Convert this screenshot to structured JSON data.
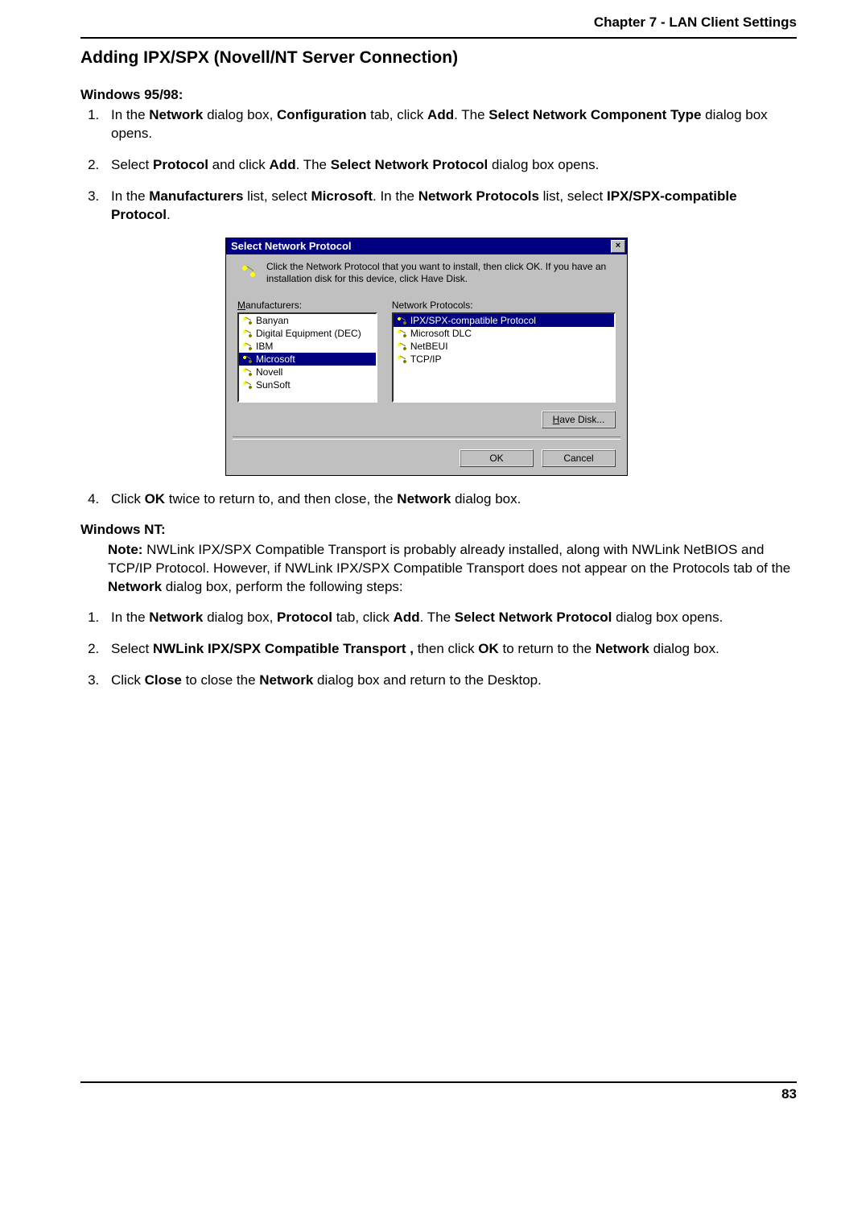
{
  "header": {
    "chapter": "Chapter 7 - LAN Client Settings"
  },
  "section": {
    "title": "Adding IPX/SPX (Novell/NT Server Connection)"
  },
  "win9598": {
    "heading": "Windows 95/98:",
    "step1_a": "In the ",
    "step1_b": "Network",
    "step1_c": " dialog box, ",
    "step1_d": "Configuration",
    "step1_e": " tab, click ",
    "step1_f": "Add",
    "step1_g": ". The ",
    "step1_h": "Select Network Component Type",
    "step1_i": " dialog box opens.",
    "step2_a": "Select ",
    "step2_b": "Protocol",
    "step2_c": " and click ",
    "step2_d": "Add",
    "step2_e": ". The ",
    "step2_f": "Select Network Protocol",
    "step2_g": " dialog box opens.",
    "step3_a": "In the ",
    "step3_b": "Manufacturers",
    "step3_c": " list, select ",
    "step3_d": "Microsoft",
    "step3_e": ". In the ",
    "step3_f": "Network Protocols",
    "step3_g": " list, select ",
    "step3_h": "IPX/SPX-compatible Protocol",
    "step3_i": ".",
    "step4_a": " Click ",
    "step4_b": "OK",
    "step4_c": " twice to return to, and then close, the ",
    "step4_d": "Network",
    "step4_e": " dialog box."
  },
  "dialog": {
    "title": "Select Network Protocol",
    "intro": "Click the Network Protocol that you want to install, then click OK. If you have an installation disk for this device, click Have Disk.",
    "manufacturers_label_pre": "M",
    "manufacturers_label_rest": "anufacturers:",
    "protocols_label": "Network Protocols:",
    "manufacturers": [
      "Banyan",
      "Digital Equipment (DEC)",
      "IBM",
      "Microsoft",
      "Novell",
      "SunSoft"
    ],
    "manufacturers_selected": "Microsoft",
    "protocols": [
      "IPX/SPX-compatible Protocol",
      "Microsoft DLC",
      "NetBEUI",
      "TCP/IP"
    ],
    "protocols_selected": "IPX/SPX-compatible Protocol",
    "have_disk_pre": "H",
    "have_disk_rest": "ave Disk...",
    "ok": "OK",
    "cancel": "Cancel"
  },
  "winnt": {
    "heading": "Windows NT:",
    "note_label": "Note:",
    "note_text": " NWLink IPX/SPX Compatible Transport is probably already installed, along with NWLink NetBIOS and TCP/IP Protocol.  However, if NWLink IPX/SPX Compatible Transport does not appear on the Protocols tab of the ",
    "note_b": "Network",
    "note_text2": " dialog box, perform the following steps:",
    "step1_a": "In the ",
    "step1_b": "Network",
    "step1_c": " dialog box, ",
    "step1_d": "Protocol",
    "step1_e": " tab, click ",
    "step1_f": "Add",
    "step1_g": ". The ",
    "step1_h": "Select Network Protocol",
    "step1_i": " dialog box opens.",
    "step2_a": "Select ",
    "step2_b": "NWLink IPX/SPX Compatible Transport ,",
    "step2_c": " then click ",
    "step2_d": "OK",
    "step2_e": " to return to the ",
    "step2_f": "Network",
    "step2_g": " dialog box.",
    "step3_a": "Click ",
    "step3_b": "Close",
    "step3_c": " to close the ",
    "step3_d": "Network",
    "step3_e": " dialog box and return to the Desktop."
  },
  "footer": {
    "page_number": "83"
  }
}
